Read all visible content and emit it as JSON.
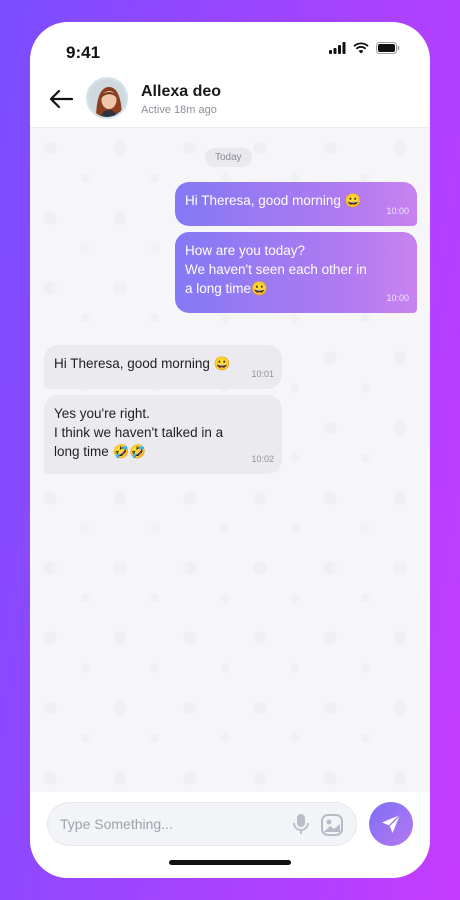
{
  "status_bar": {
    "time": "9:41"
  },
  "header": {
    "contact_name": "Allexa deo",
    "active_status": "Active 18m ago"
  },
  "chat": {
    "day_separator": "Today",
    "messages": [
      {
        "direction": "outgoing",
        "text": "Hi Theresa, good morning 😀",
        "time": "10:00"
      },
      {
        "direction": "outgoing",
        "text": "How are you today?\nWe haven't seen each other in\na long time😀",
        "time": "10:00"
      },
      {
        "direction": "incoming",
        "text": "Hi Theresa, good morning 😀",
        "time": "10:01"
      },
      {
        "direction": "incoming",
        "text": "Yes you're right.\nI think we haven't talked in a\nlong time 🤣🤣",
        "time": "10:02"
      }
    ]
  },
  "composer": {
    "placeholder": "Type Something...",
    "icons": [
      "microphone-icon",
      "gallery-icon",
      "send-icon"
    ]
  },
  "colors": {
    "background_start": "#7b4dff",
    "background_end": "#c43cff",
    "outgoing_bubble_start": "#8479f5",
    "outgoing_bubble_end": "#c883f0",
    "incoming_bubble": "#ebebef"
  }
}
